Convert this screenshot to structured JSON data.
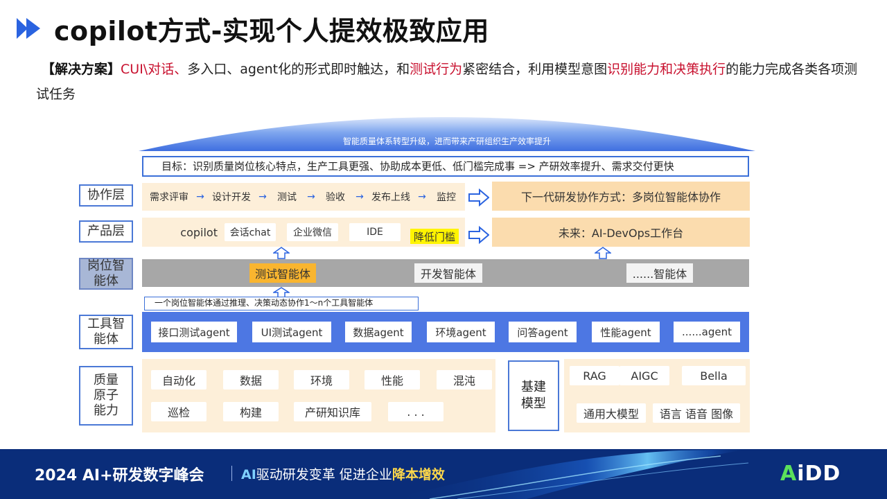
{
  "slide": {
    "title": "copilot方式-实现个人提效极致应用",
    "solution": {
      "bracket": "【解决方案】",
      "seg1_red": "CUI\\对话、",
      "seg2": "多入口、agent化的形式即时触达，和",
      "seg3_red": "测试行为",
      "seg4": "紧密结合，利用模型意图",
      "seg5_red": "识别能力和决策执行",
      "seg6": "的能力完成各类各项测试任务"
    }
  },
  "diagram": {
    "roof_text": "智能质量体系转型升级，进而带来产研组织生产效率提升",
    "goal": "目标：识别质量岗位核心特点，生产工具更强、协助成本更低、低门槛完成事 => 产研效率提升、需求交付更快",
    "collab": {
      "label": "协作层",
      "steps": [
        "需求评审",
        "设计开发",
        "测试",
        "验收",
        "发布上线",
        "监控"
      ],
      "future": "下一代研发协作方式：多岗位智能体协作"
    },
    "product": {
      "label": "产品层",
      "items": [
        "copilot",
        "会话chat",
        "企业微信",
        "IDE"
      ],
      "lower_barrier": "降低门槛",
      "future": "未来：AI-DevOps工作台"
    },
    "role_agent": {
      "label": "岗位智能体",
      "items": [
        "测试智能体",
        "开发智能体",
        "......智能体"
      ]
    },
    "tool_note": "一个岗位智能体通过推理、决策动态协作1～n个工具智能体",
    "tool_agent": {
      "label": "工具智能体",
      "items": [
        "接口测试agent",
        "UI测试agent",
        "数据agent",
        "环境agent",
        "问答agent",
        "性能agent",
        "......agent"
      ]
    },
    "atomic": {
      "label": "质量原子能力",
      "row1": [
        "自动化",
        "数据",
        "环境",
        "性能",
        "混沌"
      ],
      "row2": [
        "巡检",
        "构建",
        "产研知识库",
        ". . ."
      ],
      "base_label": "基建模型",
      "base_row1": [
        "RAG",
        "AIGC",
        "Bella"
      ],
      "base_row2": [
        "通用大模型",
        "语言 语音 图像"
      ]
    }
  },
  "footer": {
    "event": "2024 AI+研发数字峰会",
    "slogan_ai": "AI",
    "slogan_mid": "驱动研发变革  促进企业",
    "slogan_hl": "降本增效",
    "logo_a": "A",
    "logo_rest": "iDD"
  },
  "colors": {
    "accent_blue": "#2a63e0",
    "red_text": "#c8102e",
    "footer_bg": "#0a2d7a",
    "highlight_orange": "#f9b52f",
    "highlight_yellow": "#fff400"
  }
}
